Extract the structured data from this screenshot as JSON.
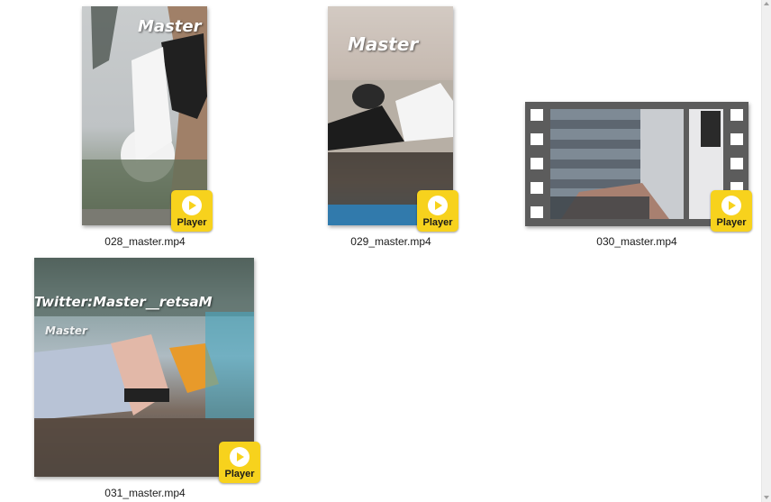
{
  "files": [
    {
      "name": "028_master.mp4",
      "watermark": "Master",
      "badge": "Player"
    },
    {
      "name": "029_master.mp4",
      "watermark": "Master",
      "badge": "Player"
    },
    {
      "name": "030_master.mp4",
      "badge": "Player"
    },
    {
      "name": "031_master.mp4",
      "watermark_top": "Twitter:Master__retsaM",
      "watermark": "Master",
      "badge": "Player"
    }
  ],
  "colors": {
    "badge": "#f7d21d",
    "background": "#ffffff",
    "filmstrip": "#5c5c5c"
  },
  "icons": {
    "badge_icon": "play-icon"
  }
}
